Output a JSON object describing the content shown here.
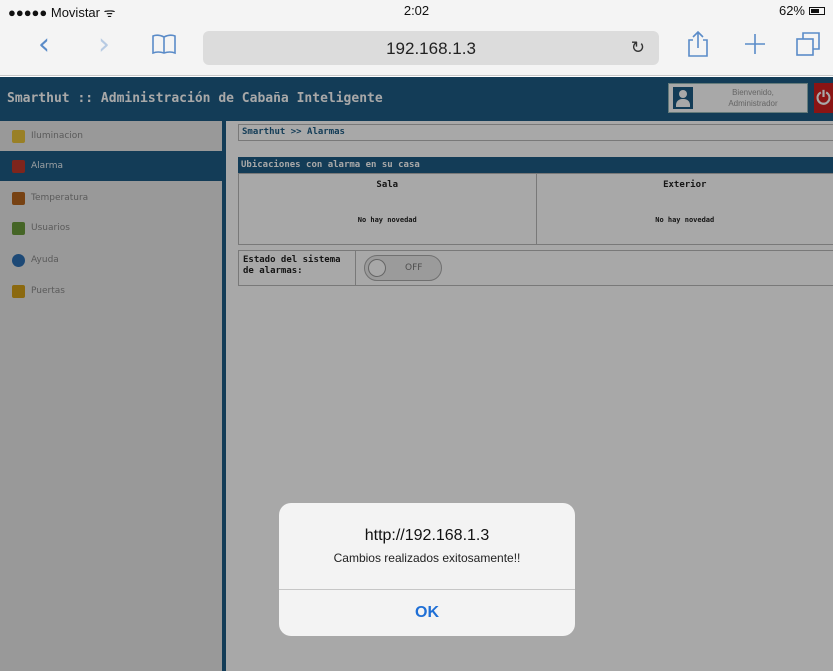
{
  "status_bar": {
    "carrier": "●●●●● Movistar ᯤ",
    "time": "2:02",
    "battery": "62%"
  },
  "browser": {
    "url": "192.168.1.3",
    "back_icon": "chevron-left-icon",
    "forward_icon": "chevron-right-icon",
    "bookmarks_icon": "book-icon",
    "reload_icon": "reload-icon",
    "share_icon": "share-icon",
    "new_tab_icon": "plus-icon",
    "tabs_icon": "tabs-icon"
  },
  "app": {
    "title": "Smarthut :: Administración de Cabaña Inteligente",
    "welcome_line1": "Bienvenido,",
    "welcome_line2": "Administrador",
    "power_glyph": "⏻"
  },
  "sidebar": {
    "items": [
      {
        "label": "Iluminacion",
        "icon": "lightbulb-icon",
        "color": "#e8c23a",
        "active": false
      },
      {
        "label": "Alarma",
        "icon": "alarm-icon",
        "color": "#c0392b",
        "active": true
      },
      {
        "label": "Temperatura",
        "icon": "thermometer-icon",
        "color": "#b5651d",
        "active": false
      },
      {
        "label": "Usuarios",
        "icon": "users-icon",
        "color": "#6a9a3a",
        "active": false
      },
      {
        "label": "Ayuda",
        "icon": "help-icon",
        "color": "#2c6fb3",
        "active": false
      },
      {
        "label": "Puertas",
        "icon": "door-icon",
        "color": "#d4a017",
        "active": false
      }
    ]
  },
  "main": {
    "breadcrumb": "Smarthut >> Alarmas",
    "section_title": "Ubicaciones con alarma en su casa",
    "locations": [
      {
        "name": "Sala",
        "status": "No hay novedad"
      },
      {
        "name": "Exterior",
        "status": "No hay novedad"
      }
    ],
    "system_label": "Estado del sistema de alarmas:",
    "toggle_state": "OFF"
  },
  "alert": {
    "title": "http://192.168.1.3",
    "message": "Cambios realizados exitosamente!!",
    "ok_label": "OK"
  },
  "colors": {
    "brand": "#1d5c84",
    "ok_blue": "#1f6fd6"
  }
}
